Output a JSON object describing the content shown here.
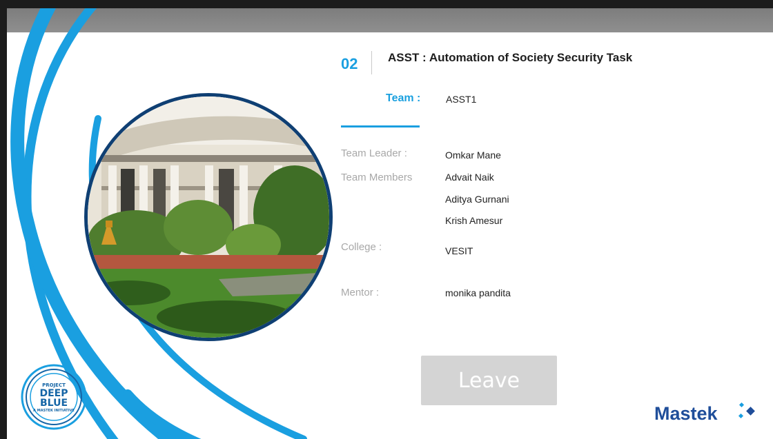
{
  "project": {
    "number": "02",
    "title": "ASST : Automation of Society Security Task"
  },
  "team": {
    "label": "Team :",
    "name": "ASST1"
  },
  "details": {
    "leader_label": "Team Leader :",
    "leader": "Omkar Mane",
    "members_label": "Team Members",
    "members": [
      "Advait Naik",
      "Aditya Gurnani",
      "Krish Amesur"
    ],
    "college_label": "College :",
    "college": "VESIT",
    "mentor_label": "Mentor :",
    "mentor": "monika pandita"
  },
  "actions": {
    "leave_label": "Leave"
  },
  "badge": {
    "line1": "PROJECT",
    "line2": "DEEP",
    "line3": "BLUE",
    "line4": "A MASTEK INITIATIVE"
  },
  "brand": {
    "name": "Mastek"
  },
  "colors": {
    "accent": "#1a9fe0",
    "ring_dark": "#0f3f73",
    "brand_blue": "#1f4e9a",
    "button_disabled": "#d4d4d4"
  }
}
